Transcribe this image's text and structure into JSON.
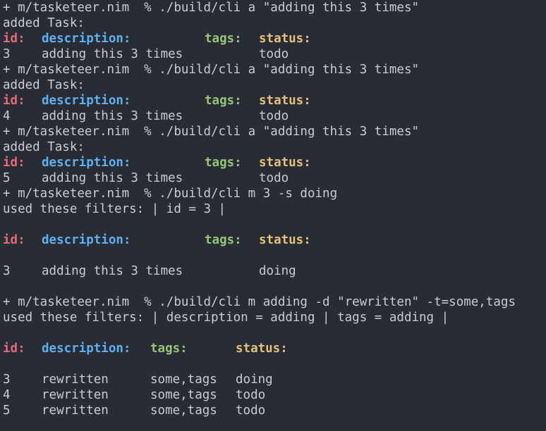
{
  "terminal": {
    "session": [
      {
        "prompt": "+ m/tasketeer.nim  % ./build/cli a \"adding this 3 times\""
      },
      {
        "text": "added Task:"
      },
      {
        "table": {
          "headers": [
            "id:",
            "description:",
            "tags:",
            "status:"
          ],
          "rows": [
            [
              "3",
              "adding this 3 times",
              "",
              "todo"
            ]
          ]
        }
      },
      {
        "prompt": "+ m/tasketeer.nim  % ./build/cli a \"adding this 3 times\""
      },
      {
        "text": "added Task:"
      },
      {
        "table": {
          "headers": [
            "id:",
            "description:",
            "tags:",
            "status:"
          ],
          "rows": [
            [
              "4",
              "adding this 3 times",
              "",
              "todo"
            ]
          ]
        }
      },
      {
        "prompt": "+ m/tasketeer.nim  % ./build/cli a \"adding this 3 times\""
      },
      {
        "text": "added Task:"
      },
      {
        "table": {
          "headers": [
            "id:",
            "description:",
            "tags:",
            "status:"
          ],
          "rows": [
            [
              "5",
              "adding this 3 times",
              "",
              "todo"
            ]
          ]
        }
      },
      {
        "prompt": "+ m/tasketeer.nim  % ./build/cli m 3 -s doing"
      },
      {
        "text": "used these filters: | id = 3 |"
      },
      {
        "blank": true
      },
      {
        "table": {
          "headers": [
            "id:",
            "description:",
            "tags:",
            "status:"
          ],
          "rows": [
            [
              "3",
              "adding this 3 times",
              "",
              "doing"
            ]
          ],
          "spaced": true
        }
      },
      {
        "blank": true
      },
      {
        "prompt": "+ m/tasketeer.nim  % ./build/cli m adding -d \"rewritten\" -t=some,tags"
      },
      {
        "text": "used these filters: | description = adding | tags = adding |"
      },
      {
        "blank": true
      },
      {
        "table": {
          "headers": [
            "id:",
            "description:",
            "tags:",
            "status:"
          ],
          "rows": [
            [
              "3",
              "rewritten",
              "some,tags",
              "doing"
            ],
            [
              "4",
              "rewritten",
              "some,tags",
              "todo"
            ],
            [
              "5",
              "rewritten",
              "some,tags",
              "todo"
            ]
          ],
          "spaced": true,
          "narrow": true
        }
      }
    ]
  },
  "colors": {
    "background": "#282c34",
    "foreground": "#c8ccd4",
    "id_header": "#e06c75",
    "description_header": "#61afef",
    "tags_header": "#98c379",
    "status_header": "#e5c07b"
  }
}
